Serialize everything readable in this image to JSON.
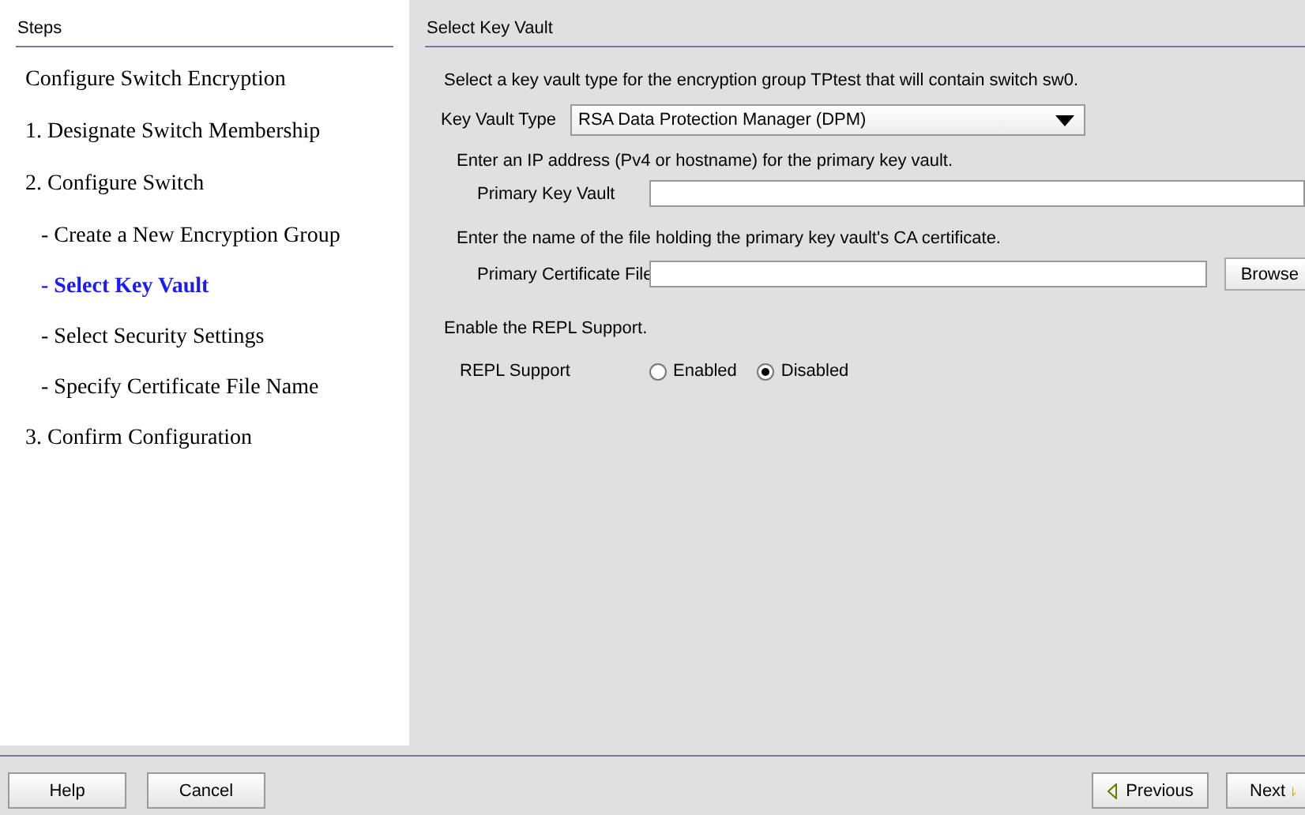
{
  "steps": {
    "title": "Steps",
    "items": [
      {
        "label": "Configure Switch Encryption",
        "kind": "heading",
        "selected": false
      },
      {
        "label": "1. Designate Switch Membership",
        "kind": "step",
        "selected": false
      },
      {
        "label": "2. Configure Switch",
        "kind": "step",
        "selected": false
      },
      {
        "label": "- Create a New Encryption Group",
        "kind": "substep",
        "selected": false
      },
      {
        "label": "- Select Key Vault",
        "kind": "substep",
        "selected": true
      },
      {
        "label": "- Select Security Settings",
        "kind": "substep",
        "selected": false
      },
      {
        "label": "- Specify Certificate File Name",
        "kind": "substep",
        "selected": false
      },
      {
        "label": "3. Confirm Configuration",
        "kind": "step",
        "selected": false
      }
    ]
  },
  "panel": {
    "title": "Select Key Vault",
    "intro": "Select a key vault type for the encryption group TPtest that will contain switch sw0.",
    "key_vault_type": {
      "label": "Key Vault Type",
      "value": "RSA Data Protection Manager (DPM)"
    },
    "primary_hint": "Enter an IP address (Pv4 or hostname) for the primary key vault.",
    "primary_key_vault": {
      "label": "Primary Key Vault"
    },
    "cert_hint": "Enter the name of the file holding the primary key vault's CA certificate.",
    "primary_certificate": {
      "label": "Primary Certificate File",
      "button": "Browse"
    },
    "repl_hint": "Enable the REPL Support.",
    "repl": {
      "label": "REPL Support",
      "options": [
        {
          "label": "Enabled",
          "selected": false
        },
        {
          "label": "Disabled",
          "selected": true
        }
      ]
    }
  },
  "footer": {
    "left": [
      "Help",
      "Cancel"
    ],
    "previous": "Previous",
    "next": "Next"
  }
}
